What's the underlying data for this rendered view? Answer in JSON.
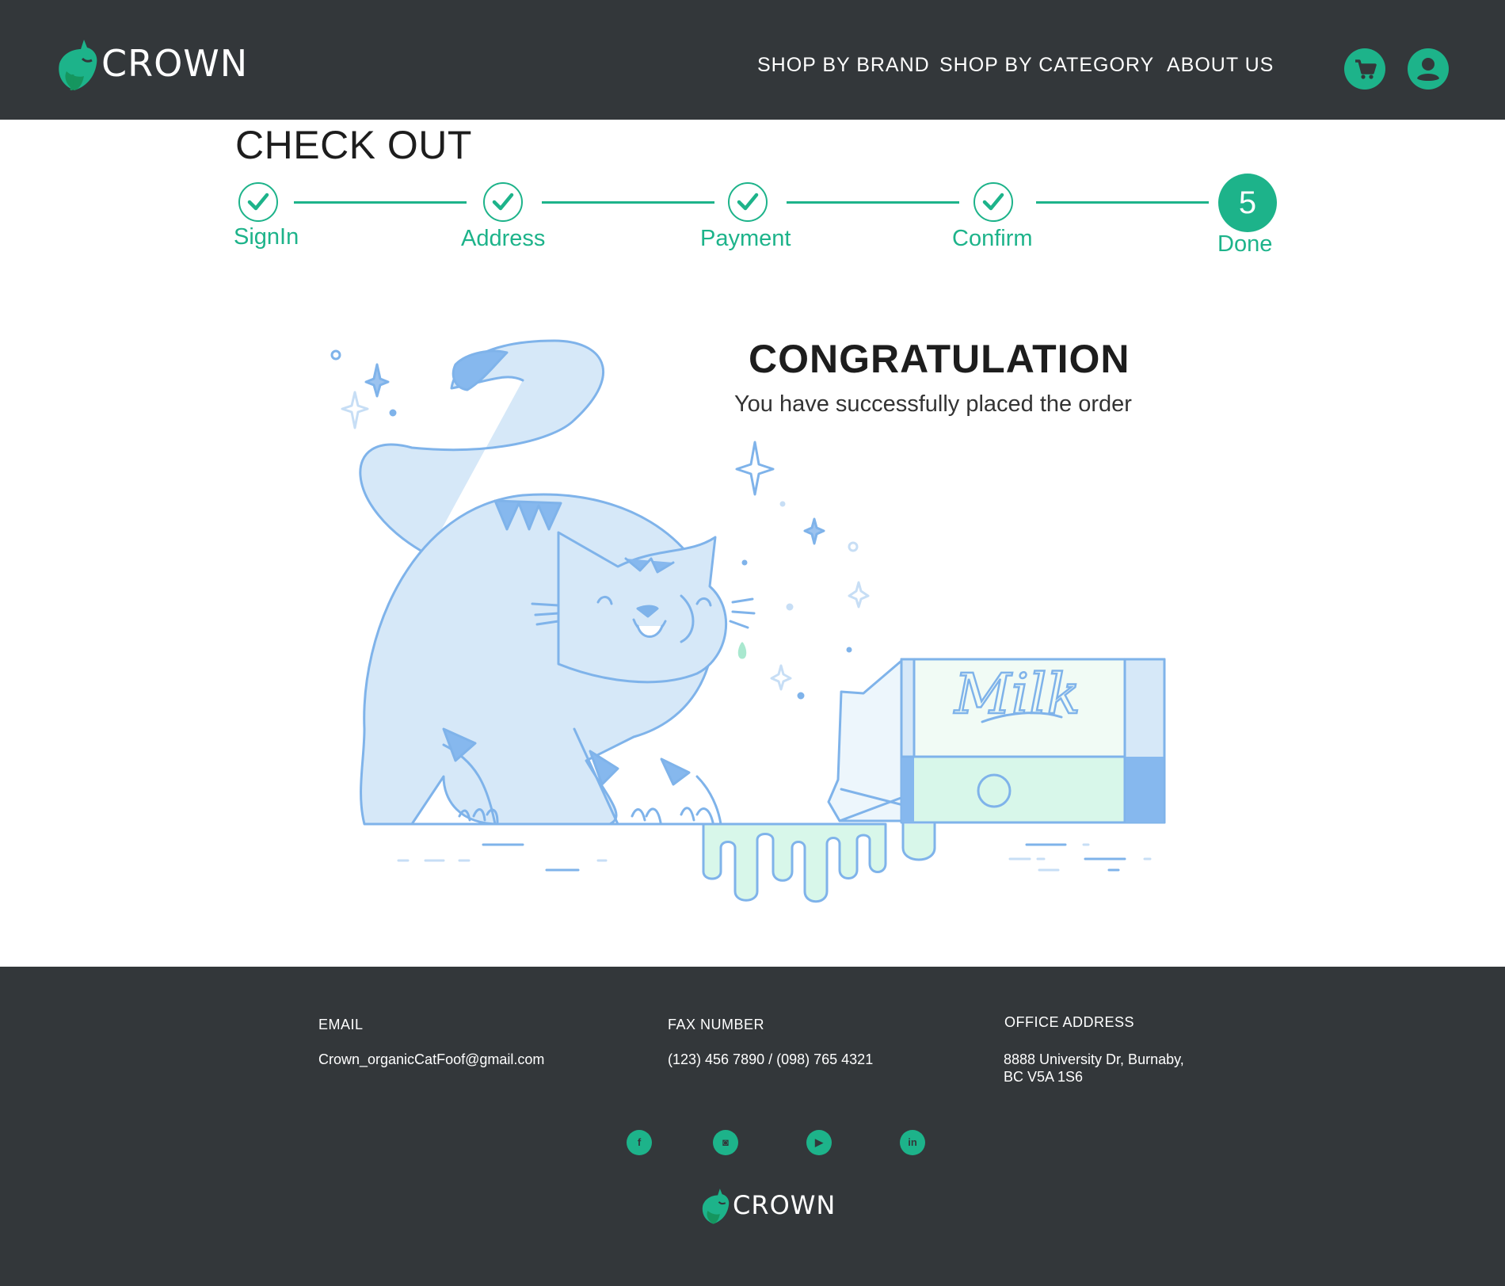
{
  "brand": {
    "name": "CROWN",
    "accent": "#1db38a",
    "dark_bg": "#33373a"
  },
  "nav": {
    "items": [
      {
        "label": "SHOP BY BRAND"
      },
      {
        "label": "SHOP BY CATEGORY"
      },
      {
        "label": "ABOUT US"
      }
    ],
    "icons": [
      "cart-icon",
      "user-icon"
    ]
  },
  "checkout": {
    "title": "CHECK OUT",
    "steps": [
      {
        "label": "SignIn",
        "state": "done"
      },
      {
        "label": "Address",
        "state": "done"
      },
      {
        "label": "Payment",
        "state": "done"
      },
      {
        "label": "Confirm",
        "state": "done"
      },
      {
        "label": "Done",
        "state": "active",
        "number": "5"
      }
    ]
  },
  "message": {
    "title": "CONGRATULATION",
    "subtitle": "You have successfully placed the order"
  },
  "illustration": {
    "carton_text": "Milk"
  },
  "footer": {
    "email": {
      "label": "EMAIL",
      "value": "Crown_organicCatFoof@gmail.com"
    },
    "fax": {
      "label": "FAX NUMBER",
      "value": "(123) 456 7890 / (098) 765 4321"
    },
    "address": {
      "label": "OFFICE ADDRESS",
      "line1": "8888 University Dr, Burnaby,",
      "line2": "BC V5A 1S6"
    },
    "social": [
      {
        "icon": "facebook-icon",
        "glyph": "f"
      },
      {
        "icon": "instagram-icon",
        "glyph": "◙"
      },
      {
        "icon": "youtube-icon",
        "glyph": "▶"
      },
      {
        "icon": "linkedin-icon",
        "glyph": "in"
      }
    ]
  }
}
